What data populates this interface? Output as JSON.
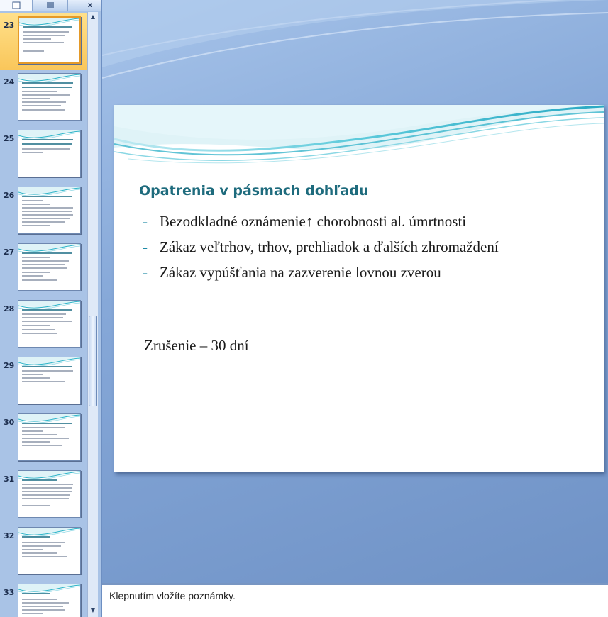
{
  "panel": {
    "tab_slides_icon": "slides-icon",
    "tab_outline_icon": "outline-icon",
    "close_label": "x"
  },
  "thumbnails": [
    {
      "number": "23",
      "selected": true
    },
    {
      "number": "24",
      "selected": false
    },
    {
      "number": "25",
      "selected": false
    },
    {
      "number": "26",
      "selected": false
    },
    {
      "number": "27",
      "selected": false
    },
    {
      "number": "28",
      "selected": false
    },
    {
      "number": "29",
      "selected": false
    },
    {
      "number": "30",
      "selected": false
    },
    {
      "number": "31",
      "selected": false
    },
    {
      "number": "32",
      "selected": false
    },
    {
      "number": "33",
      "selected": false
    }
  ],
  "slide": {
    "title": "Opatrenia v pásmach dohľadu",
    "bullets": [
      {
        "dash": "-",
        "text": "Bezodkladné oznámenie↑ chorobnosti al. úmrtnosti"
      },
      {
        "dash": "-",
        "text": "Zákaz veľtrhov, trhov, prehliadok a ďalších zhromaždení"
      },
      {
        "dash": "-",
        "text": "Zákaz vypúšťania na zazverenie lovnou zverou"
      }
    ],
    "extra_line": "Zrušenie – 30 dní"
  },
  "notes": {
    "placeholder": "Klepnutím vložíte poznámky."
  },
  "colors": {
    "title": "#1e6b7d",
    "wave": "#2fb5c9",
    "selection": "#f9c65a"
  }
}
